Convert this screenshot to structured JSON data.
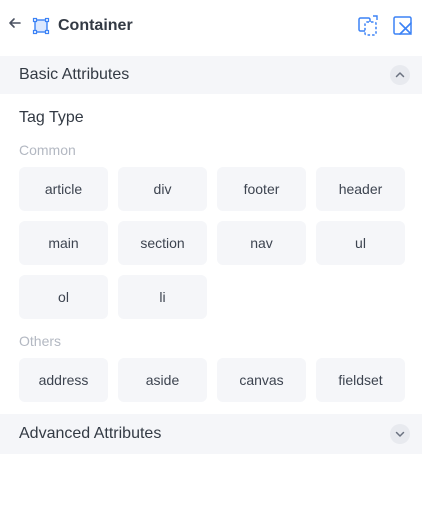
{
  "header": {
    "title": "Container",
    "back_icon": "arrow-left-icon",
    "element_icon": "container-square-icon",
    "actions": [
      {
        "name": "copy-element-icon"
      },
      {
        "name": "remove-element-icon"
      }
    ],
    "accent_color": "#3b82f6"
  },
  "basic": {
    "title": "Basic Attributes",
    "expanded": true,
    "tag_type_label": "Tag Type",
    "common_label": "Common",
    "common_tags": [
      "article",
      "div",
      "footer",
      "header",
      "main",
      "section",
      "nav",
      "ul",
      "ol",
      "li"
    ],
    "others_label": "Others",
    "other_tags": [
      "address",
      "aside",
      "canvas",
      "fieldset"
    ]
  },
  "advanced": {
    "title": "Advanced Attributes",
    "expanded": false
  }
}
